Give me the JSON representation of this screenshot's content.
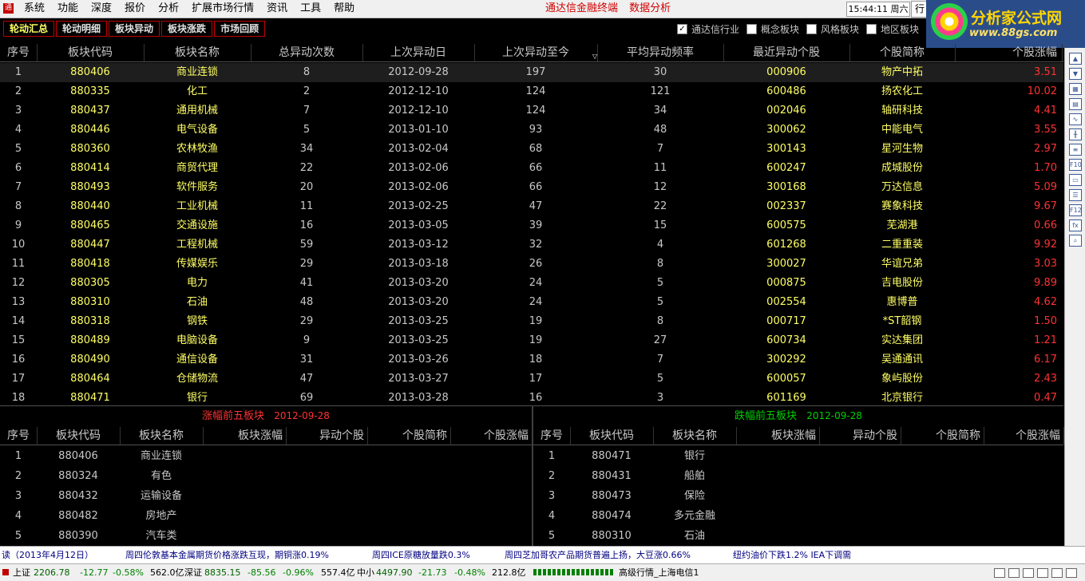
{
  "menubar": {
    "items": [
      "系统",
      "功能",
      "深度",
      "报价",
      "分析",
      "扩展市场行情",
      "资讯",
      "工具",
      "帮助"
    ],
    "brand": [
      "通达信金融终端",
      "数据分析"
    ],
    "clock": "15:44:11 周六",
    "clock_btn": "行"
  },
  "logo": {
    "title": "分析家公式网",
    "url": "www.88gs.com"
  },
  "subtabs": [
    "轮动汇总",
    "轮动明细",
    "板块异动",
    "板块涨跌",
    "市场回顾"
  ],
  "filters": [
    {
      "label": "通达信行业",
      "checked": "✓"
    },
    {
      "label": "概念板块",
      "checked": ""
    },
    {
      "label": "风格板块",
      "checked": ""
    },
    {
      "label": "地区板块",
      "checked": ""
    }
  ],
  "main_table": {
    "headers": [
      "序号",
      "板块代码",
      "板块名称",
      "总异动次数",
      "上次异动日",
      "上次异动至今",
      "平均异动频率",
      "最近异动个股",
      "个股简称",
      "个股涨幅"
    ],
    "rows": [
      [
        "1",
        "880406",
        "商业连锁",
        "8",
        "2012-09-28",
        "197",
        "30",
        "000906",
        "物产中拓",
        "3.51"
      ],
      [
        "2",
        "880335",
        "化工",
        "2",
        "2012-12-10",
        "124",
        "121",
        "600486",
        "扬农化工",
        "10.02"
      ],
      [
        "3",
        "880437",
        "通用机械",
        "7",
        "2012-12-10",
        "124",
        "34",
        "002046",
        "轴研科技",
        "4.41"
      ],
      [
        "4",
        "880446",
        "电气设备",
        "5",
        "2013-01-10",
        "93",
        "48",
        "300062",
        "中能电气",
        "3.55"
      ],
      [
        "5",
        "880360",
        "农林牧渔",
        "34",
        "2013-02-04",
        "68",
        "7",
        "300143",
        "星河生物",
        "2.97"
      ],
      [
        "6",
        "880414",
        "商贸代理",
        "22",
        "2013-02-06",
        "66",
        "11",
        "600247",
        "成城股份",
        "1.70"
      ],
      [
        "7",
        "880493",
        "软件服务",
        "20",
        "2013-02-06",
        "66",
        "12",
        "300168",
        "万达信息",
        "5.09"
      ],
      [
        "8",
        "880440",
        "工业机械",
        "11",
        "2013-02-25",
        "47",
        "22",
        "002337",
        "赛象科技",
        "9.67"
      ],
      [
        "9",
        "880465",
        "交通设施",
        "16",
        "2013-03-05",
        "39",
        "15",
        "600575",
        "芜湖港",
        "0.66"
      ],
      [
        "10",
        "880447",
        "工程机械",
        "59",
        "2013-03-12",
        "32",
        "4",
        "601268",
        "二重重装",
        "9.92"
      ],
      [
        "11",
        "880418",
        "传媒娱乐",
        "29",
        "2013-03-18",
        "26",
        "8",
        "300027",
        "华谊兄弟",
        "3.03"
      ],
      [
        "12",
        "880305",
        "电力",
        "41",
        "2013-03-20",
        "24",
        "5",
        "000875",
        "吉电股份",
        "9.89"
      ],
      [
        "13",
        "880310",
        "石油",
        "48",
        "2013-03-20",
        "24",
        "5",
        "002554",
        "惠博普",
        "4.62"
      ],
      [
        "14",
        "880318",
        "钢铁",
        "29",
        "2013-03-25",
        "19",
        "8",
        "000717",
        "*ST韶钢",
        "1.50"
      ],
      [
        "15",
        "880489",
        "电脑设备",
        "9",
        "2013-03-25",
        "19",
        "27",
        "600734",
        "实达集团",
        "1.21"
      ],
      [
        "16",
        "880490",
        "通信设备",
        "31",
        "2013-03-26",
        "18",
        "7",
        "300292",
        "吴通通讯",
        "6.17"
      ],
      [
        "17",
        "880464",
        "仓储物流",
        "47",
        "2013-03-27",
        "17",
        "5",
        "600057",
        "象屿股份",
        "2.43"
      ],
      [
        "18",
        "880471",
        "银行",
        "69",
        "2013-03-28",
        "16",
        "3",
        "601169",
        "北京银行",
        "0.47"
      ]
    ]
  },
  "top5": {
    "title": "涨幅前五板块",
    "date": "2012-09-28",
    "headers": [
      "序号",
      "板块代码",
      "板块名称",
      "板块涨幅",
      "异动个股",
      "个股简称",
      "个股涨幅"
    ],
    "rows": [
      [
        "1",
        "880406",
        "商业连锁"
      ],
      [
        "2",
        "880324",
        "有色"
      ],
      [
        "3",
        "880432",
        "运输设备"
      ],
      [
        "4",
        "880482",
        "房地产"
      ],
      [
        "5",
        "880390",
        "汽车类"
      ]
    ]
  },
  "bottom5": {
    "title": "跌幅前五板块",
    "date": "2012-09-28",
    "headers": [
      "序号",
      "板块代码",
      "板块名称",
      "板块涨幅",
      "异动个股",
      "个股简称",
      "个股涨幅"
    ],
    "rows": [
      [
        "1",
        "880471",
        "银行"
      ],
      [
        "2",
        "880431",
        "船舶"
      ],
      [
        "3",
        "880473",
        "保险"
      ],
      [
        "4",
        "880474",
        "多元金融"
      ],
      [
        "5",
        "880310",
        "石油"
      ]
    ]
  },
  "ticker": [
    "读（2013年4月12日）",
    "周四伦敦基本金属期货价格涨跌互现，期铜涨0.19%",
    "周四ICE原糖放量跌0.3%",
    "周四芝加哥农产品期货普遍上扬，大豆涨0.66%",
    "纽约油价下跌1.2% IEA下调需"
  ],
  "status": {
    "sh_label": "上证",
    "sh_value": "2206.78",
    "sh_change": "-12.77",
    "sh_pct": "-0.58%",
    "sh_amount": "562.0亿",
    "sz_label": "深证",
    "sz_value": "8835.15",
    "sz_change": "-85.56",
    "sz_pct": "-0.96%",
    "sz_amount": "557.4亿",
    "zx_label": "中小",
    "zx_value": "4497.90",
    "zx_change": "-21.73",
    "zx_pct": "-0.48%",
    "zx_amount": "212.8亿",
    "server": "高级行情_上海电信1"
  },
  "colors": {
    "yellow": "#ffff66",
    "red": "#ff3232",
    "green": "#00d000",
    "gray": "#c8c8c8"
  }
}
